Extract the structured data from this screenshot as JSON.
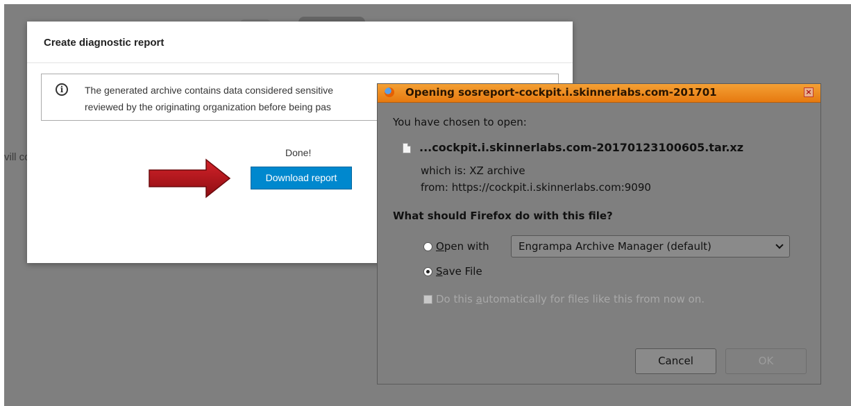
{
  "background": {
    "partial_text": "vill co"
  },
  "modal": {
    "title": "Create diagnostic report",
    "alert_line1": "The generated archive contains data considered sensitive",
    "alert_line2": "reviewed by the originating organization before being pas",
    "status": "Done!",
    "download_button": "Download report",
    "arrow_color": "#b8141a"
  },
  "firefox_dialog": {
    "title": "Opening sosreport-cockpit.i.skinnerlabs.com-201701",
    "intro": "You have chosen to open:",
    "filename": "...cockpit.i.skinnerlabs.com-20170123100605.tar.xz",
    "which_is": "which is: XZ archive",
    "from": "from: https://cockpit.i.skinnerlabs.com:9090",
    "question": "What should Firefox do with this file?",
    "open_with_label_ul": "O",
    "open_with_label_rest": "pen with",
    "open_with_app": "Engrampa Archive Manager (default)",
    "save_file_label_ul": "S",
    "save_file_label_rest": "ave File",
    "selected_option": "Save File",
    "auto_label_pre": "Do this ",
    "auto_label_ul": "a",
    "auto_label_post": "utomatically for files like this from now on.",
    "cancel_button": "Cancel",
    "ok_button": "OK",
    "titlebar_color": "#e98a1e"
  }
}
